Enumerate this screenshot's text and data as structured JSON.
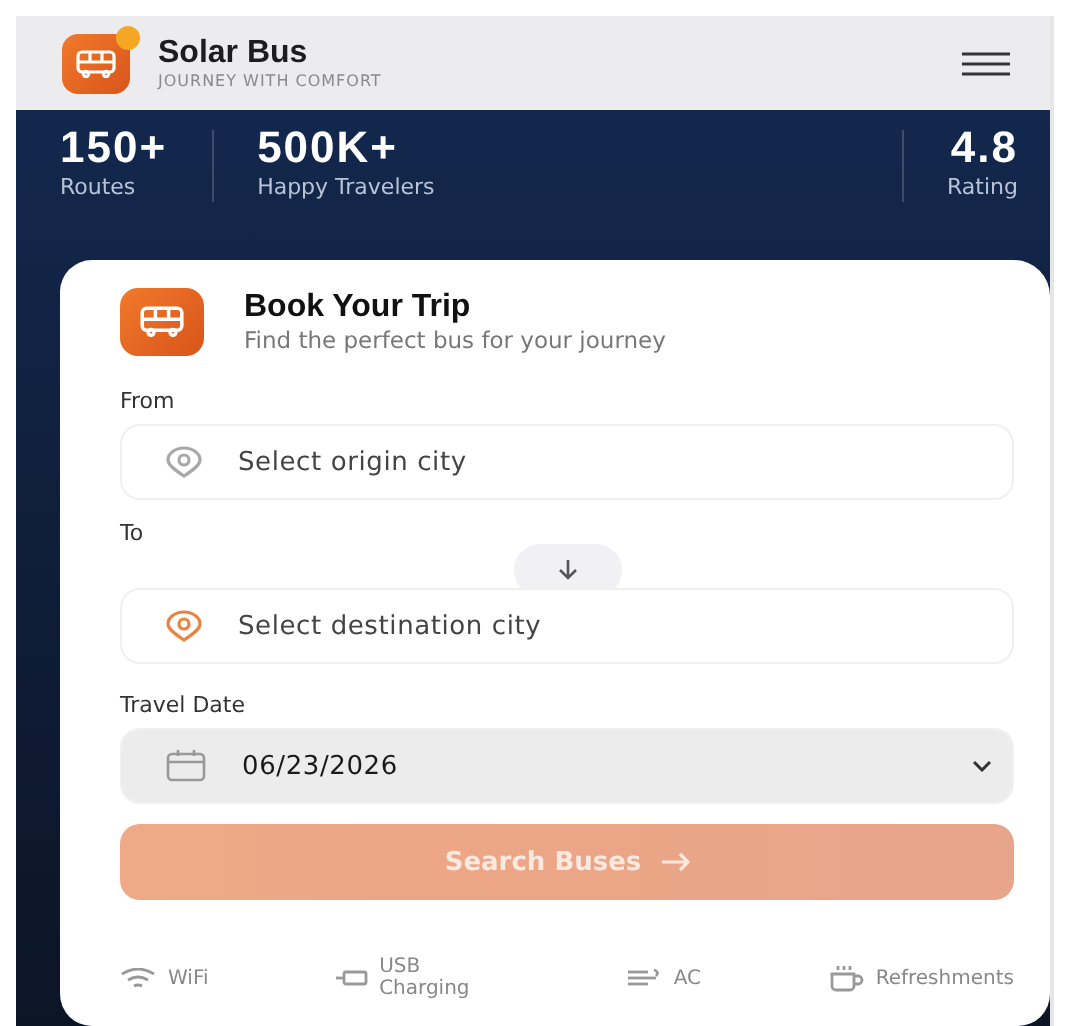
{
  "header": {
    "title": "Solar Bus",
    "tagline": "JOURNEY WITH COMFORT",
    "badge": true
  },
  "stats": [
    {
      "value": "150+",
      "label": "Routes"
    },
    {
      "value": "500K+",
      "label": "Happy Travelers"
    },
    {
      "value": "4.8",
      "label": "Rating"
    }
  ],
  "card": {
    "title": "Book Your Trip",
    "subtitle": "Find the perfect bus for your journey"
  },
  "fields": [
    {
      "kind": "origin",
      "label": "From",
      "placeholder": "Select origin city"
    },
    {
      "kind": "destination",
      "label": "To",
      "placeholder": "Select destination city"
    },
    {
      "kind": "date",
      "label": "Travel Date",
      "value": "06/23/2026"
    }
  ],
  "search_button": {
    "label": "Search Buses",
    "disabled": true
  },
  "amenities": [
    {
      "kind": "wifi",
      "label": "WiFi"
    },
    {
      "kind": "usb",
      "label": "USB Charging"
    },
    {
      "kind": "ac",
      "label": "AC"
    },
    {
      "kind": "cup",
      "label": "Refreshments"
    }
  ]
}
